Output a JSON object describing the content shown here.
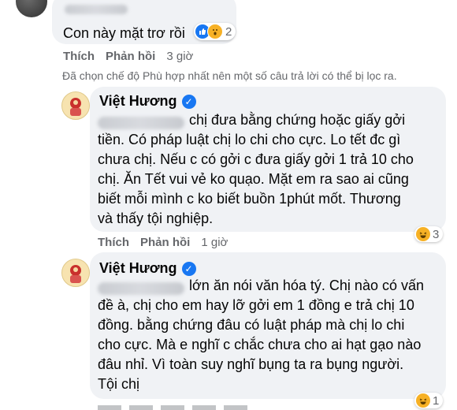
{
  "comment1": {
    "text": "Con này mặt trơ rồi",
    "reaction_count": "2",
    "reaction_icons": [
      "like-icon",
      "wow-icon"
    ],
    "actions": {
      "like": "Thích",
      "reply": "Phản hồi",
      "time": "3 giờ"
    }
  },
  "filter_notice": "Đã chọn chế độ Phù hợp nhất nên một số câu trả lời có thể bị lọc ra.",
  "reply1": {
    "author": "Việt Hương",
    "lines": [
      "chị đưa bằng chứng hoặc giấy gởi",
      "tiền. Có pháp luật chị lo chi cho cực. Lo tết đc gì",
      "chưa chị. Nếu c có gởi c đưa giấy gởi 1 trả 10 cho",
      "chị. Ăn Tết vui vẻ ko quạo. Mặt em ra sao ai cũng",
      "biết mỗi mình c ko biết buồn 1phút mốt. Thương",
      "và thấy tội nghiệp."
    ],
    "reaction_count": "3",
    "actions": {
      "like": "Thích",
      "reply": "Phản hồi",
      "time": "1 giờ"
    }
  },
  "reply2": {
    "author": "Việt Hương",
    "lines": [
      "lớn ăn nói văn hóa tý. Chị nào có vấn",
      "đề à, chị cho em hay lỡ gởi em 1 đồng e trả chị 10",
      "đồng. bằng chứng đâu có luật pháp mà chị lo chi",
      "cho cực. Mà e nghĩ c chắc chưa cho ai hạt gạo nào",
      "đâu nhỉ. Vì toàn suy nghĩ bụng ta ra bụng người.",
      "Tội chị"
    ],
    "reaction_count": "1"
  },
  "colors": {
    "like_blue": "#1877f2",
    "haha_yellow": "#f7b125",
    "text_gray": "#65676b"
  }
}
